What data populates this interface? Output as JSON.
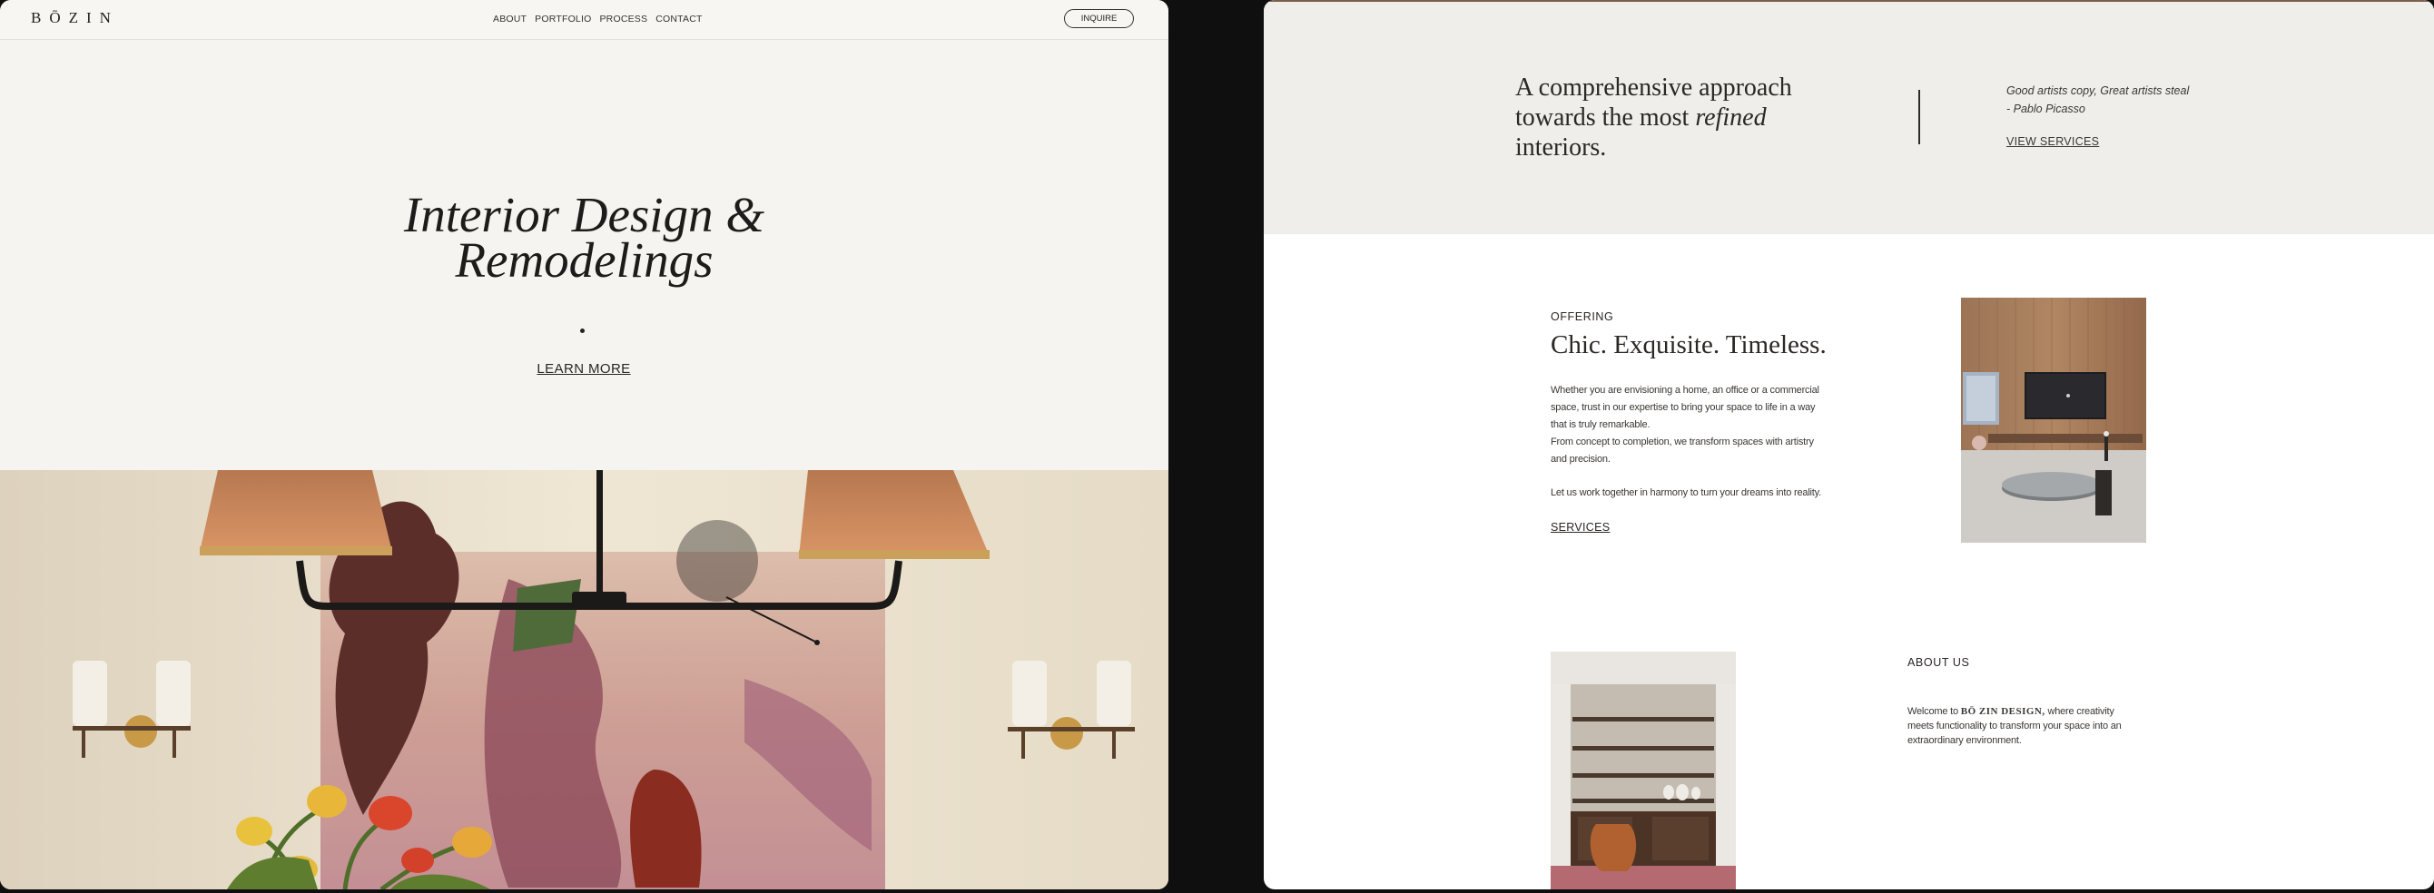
{
  "left": {
    "nav": {
      "logo": "BŌZIN",
      "links": [
        "ABOUT",
        "PORTFOLIO",
        "PROCESS",
        "CONTACT"
      ],
      "inquire_label": "INQUIRE"
    },
    "hero": {
      "title_line1": "Interior Design &",
      "title_line2": "Remodelings",
      "cta": "LEARN MORE"
    }
  },
  "right": {
    "intro": {
      "approach_line1": "A comprehensive approach",
      "approach_line2_prefix": "towards the most ",
      "approach_emphasis": "refined",
      "approach_line3": "interiors.",
      "quote_line1": "Good artists copy, Great artists steal",
      "quote_line2": "- Pablo Picasso",
      "view_services": "VIEW SERVICES"
    },
    "offering": {
      "label": "OFFERING",
      "heading": "Chic. Exquisite. Timeless.",
      "paragraph1": "Whether you are envisioning a home, an office or a commercial space, trust in our expertise to bring your space to life in a way that is truly remarkable.",
      "paragraph2": "From concept to completion, we transform spaces with artistry and precision.",
      "paragraph3": "Let us work together in harmony to turn your dreams into reality.",
      "services_link": "SERVICES"
    },
    "about": {
      "label": "ABOUT US",
      "text_prefix": "Welcome to ",
      "brand": "BŌ ZIN DESIGN,",
      "text_suffix": " where creativity meets functionality to transform your space into an extraordinary environment."
    }
  },
  "colors": {
    "page_background": "#0f0f0f",
    "hero_background": "#f5f4f0",
    "band_background": "#f0eeea",
    "text": "#1f1d1b"
  }
}
